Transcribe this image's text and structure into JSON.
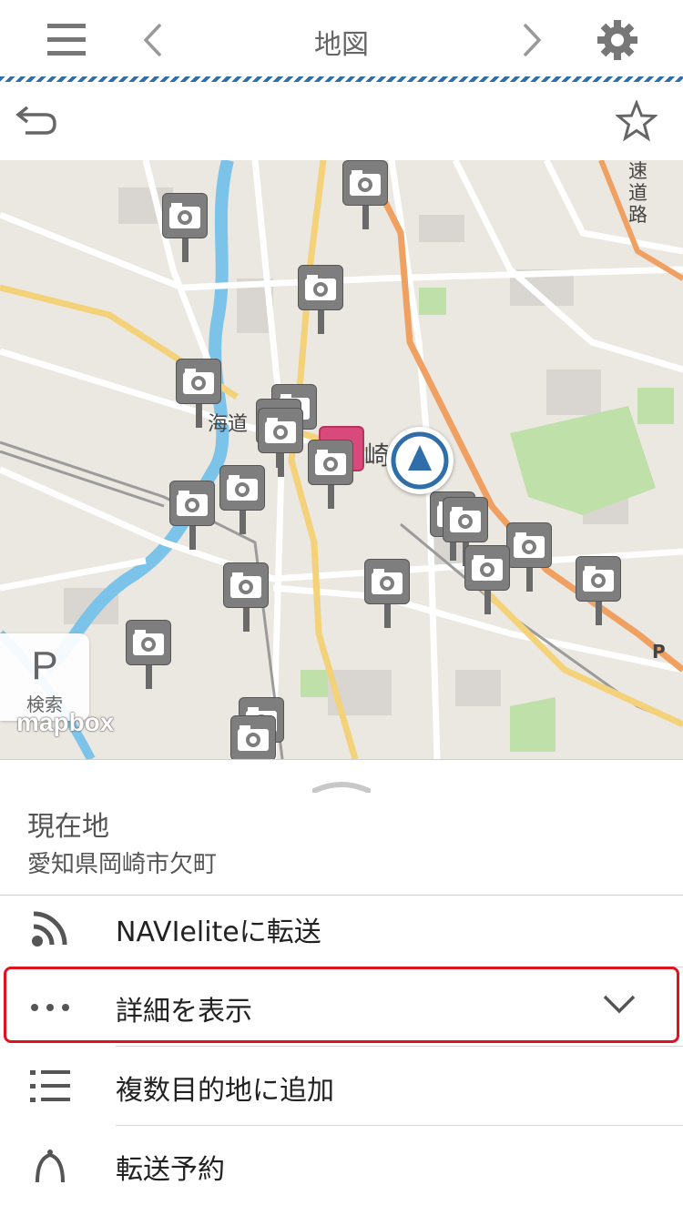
{
  "header": {
    "title": "地図",
    "icons": [
      "menu-icon",
      "chevron-left-icon",
      "chevron-right-icon",
      "gear-icon"
    ]
  },
  "subbar": {
    "icons": [
      "back-icon",
      "star-icon"
    ]
  },
  "map": {
    "labels": {
      "road_right": "速道路",
      "road_left": "海道",
      "station_char": "崎",
      "parking_marker": "P"
    },
    "parking_search": {
      "symbol": "P",
      "label": "検索"
    },
    "attribution": "mapbox"
  },
  "panel": {
    "place_title": "現在地",
    "place_address": "愛知県岡崎市欠町",
    "actions": [
      {
        "label": "NAVIeliteに転送",
        "icon": "rss-icon"
      },
      {
        "label": "詳細を表示",
        "icon": "more-dots-icon",
        "expanded": false
      },
      {
        "label": "複数目的地に追加",
        "icon": "list-icon"
      },
      {
        "label": "転送予約",
        "icon": "bell-icon"
      }
    ]
  },
  "colors": {
    "accent": "#2f6ea8",
    "highlight": "#e0121e",
    "camera": "#7e7e7e",
    "station": "#d94a7c",
    "river": "#7cc3ea",
    "park": "#bfe0a8",
    "expressway": "#f0a060"
  }
}
